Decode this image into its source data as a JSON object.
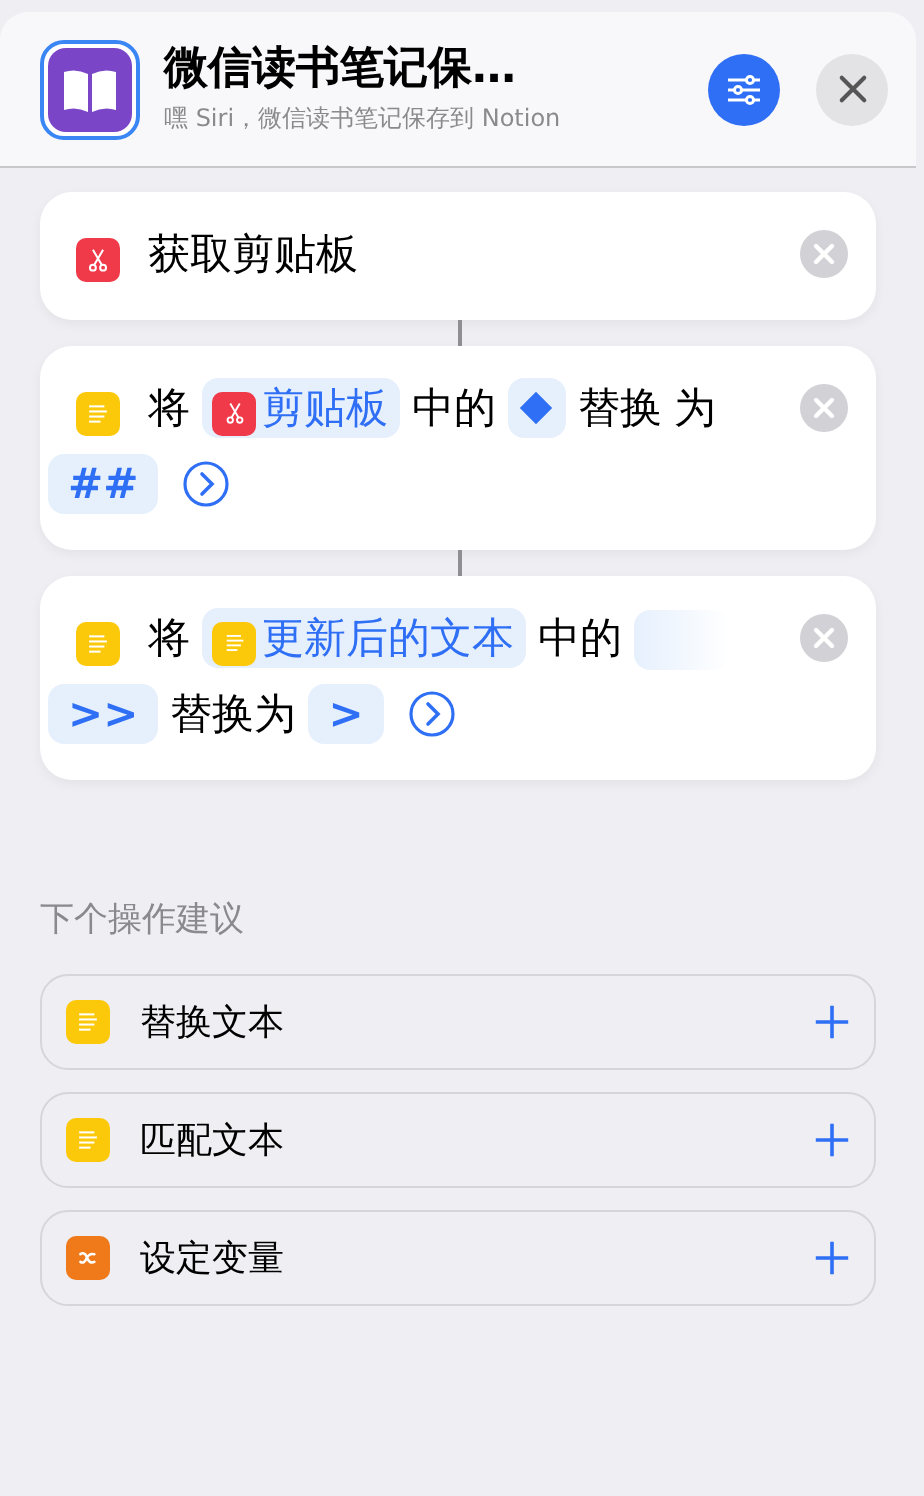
{
  "header": {
    "title": "微信读书笔记保…",
    "subtitle": "嘿 Siri，微信读书笔记保存到 Notion"
  },
  "actions": [
    {
      "tokens": [
        {
          "kind": "scissors_icon"
        },
        {
          "kind": "text",
          "text": "获取剪贴板"
        }
      ]
    },
    {
      "tokens": [
        {
          "kind": "lines_icon"
        },
        {
          "kind": "text",
          "text": "将"
        },
        {
          "kind": "clipboard_variable",
          "text": "剪贴板"
        },
        {
          "kind": "text",
          "text": "中的"
        },
        {
          "kind": "diamond_variable"
        },
        {
          "kind": "text",
          "text": "替换"
        },
        {
          "kind": "text",
          "text": "为"
        },
        {
          "kind": "value",
          "text": "##"
        },
        {
          "kind": "expand"
        }
      ]
    },
    {
      "tokens": [
        {
          "kind": "lines_icon"
        },
        {
          "kind": "text",
          "text": "将"
        },
        {
          "kind": "text_variable",
          "text": "更新后的文本"
        },
        {
          "kind": "text",
          "text": "中的"
        },
        {
          "kind": "split_value",
          "text": ">>"
        },
        {
          "kind": "text",
          "text": "替换为"
        },
        {
          "kind": "value",
          "text": ">"
        },
        {
          "kind": "expand"
        }
      ]
    }
  ],
  "suggestions": {
    "title": "下个操作建议",
    "items": [
      {
        "kind": "text",
        "label": "替换文本"
      },
      {
        "kind": "text",
        "label": "匹配文本"
      },
      {
        "kind": "variable",
        "label": "设定变量"
      }
    ]
  }
}
